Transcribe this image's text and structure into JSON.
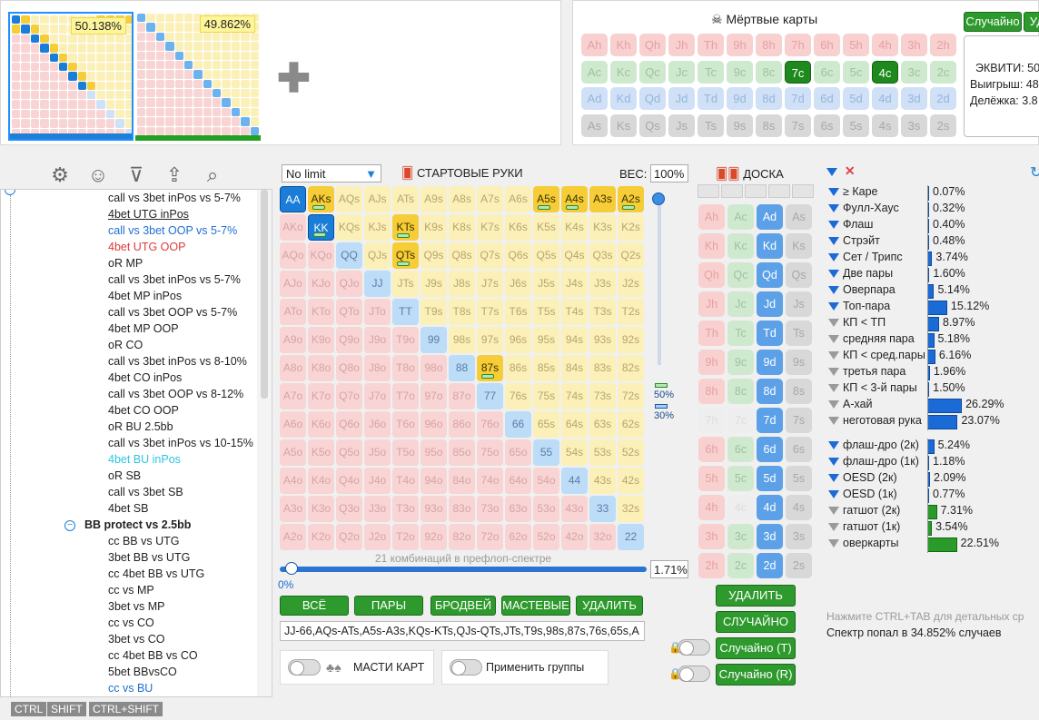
{
  "top": {
    "range1_pct": "50.138%",
    "range2_pct": "49.862%",
    "plus_icon": "plus-icon"
  },
  "dead": {
    "title": "Мёртвые карты",
    "random_btn": "Случайно",
    "delete_btn": "УД",
    "ranks": [
      "A",
      "K",
      "Q",
      "J",
      "T",
      "9",
      "8",
      "7",
      "6",
      "5",
      "4",
      "3",
      "2"
    ],
    "suits": [
      "h",
      "c",
      "d",
      "s"
    ],
    "selected": [
      "7c",
      "4c"
    ],
    "equity_label": "ЭКВИТИ: 50",
    "wins_label": "Выигрыш: 48",
    "split_label": "Делёжка: 3.8"
  },
  "toolbar": {
    "icons": [
      "gear-icon",
      "user-icon",
      "filter-add-icon",
      "export-icon",
      "search-icon"
    ]
  },
  "tree": {
    "items": [
      {
        "label": "call vs 3bet inPos vs 5-7%",
        "color": "#222"
      },
      {
        "label": "4bet UTG inPos",
        "color": "#222",
        "underline": true
      },
      {
        "label": "call  vs 3bet OOP vs 5-7%",
        "color": "#1f6fd1"
      },
      {
        "label": "4bet UTG OOP",
        "color": "#e03a3a"
      },
      {
        "label": "oR MP",
        "color": "#222"
      },
      {
        "label": "call vs 3bet inPos vs 5-7%",
        "color": "#222"
      },
      {
        "label": "4bet MP inPos",
        "color": "#222"
      },
      {
        "label": "call vs 3bet OOP vs 5-7%",
        "color": "#222"
      },
      {
        "label": "4bet MP OOP",
        "color": "#222"
      },
      {
        "label": "oR CO",
        "color": "#222"
      },
      {
        "label": "call vs 3bet inPos vs 8-10%",
        "color": "#222"
      },
      {
        "label": "4bet CO inPos",
        "color": "#222"
      },
      {
        "label": "call vs 3bet OOP vs 8-12%",
        "color": "#222"
      },
      {
        "label": "4bet CO OOP",
        "color": "#222"
      },
      {
        "label": "oR BU 2.5bb",
        "color": "#222"
      },
      {
        "label": "call vs 3bet inPos vs 10-15%",
        "color": "#222"
      },
      {
        "label": "4bet BU inPos",
        "color": "#2cc6e0"
      },
      {
        "label": "oR SB",
        "color": "#222"
      },
      {
        "label": "call vs 3bet SB",
        "color": "#222"
      },
      {
        "label": "4bet SB",
        "color": "#222"
      }
    ],
    "group_label": "BB protect vs 2.5bb",
    "group_items": [
      {
        "label": "cc BB vs UTG",
        "color": "#222"
      },
      {
        "label": "3bet BB vs UTG",
        "color": "#222"
      },
      {
        "label": "cc 4bet BB vs UTG",
        "color": "#222"
      },
      {
        "label": "cc vs MP",
        "color": "#222"
      },
      {
        "label": "3bet vs MP",
        "color": "#222"
      },
      {
        "label": "cc vs CO",
        "color": "#222"
      },
      {
        "label": "3bet vs CO",
        "color": "#222"
      },
      {
        "label": "cc 4bet BB vs CO",
        "color": "#222"
      },
      {
        "label": "5bet BBvsCO",
        "color": "#222"
      },
      {
        "label": "cc vs BU",
        "color": "#1f6fd1"
      }
    ],
    "kbd": [
      "CTRL",
      "SHIFT",
      "CTRL+SHIFT"
    ]
  },
  "range": {
    "limit_select": "No limit",
    "title": "СТАРТОВЫЕ РУКИ",
    "weight_label": "ВЕС:",
    "weight_value": "100%",
    "combos_text": "21 комбинаций в префлоп-спектре",
    "slider_min": "0%",
    "slider_value": "1.71%",
    "slider_fraction": 0.0171,
    "side_50": "50%",
    "side_30": "30%",
    "buttons": [
      "ВСЁ",
      "ПАРЫ",
      "БРОДВЕЙ",
      "МАСТЕВЫЕ",
      "УДАЛИТЬ"
    ],
    "range_text": "JJ-66,AQs-ATs,A5s-A3s,KQs-KTs,QJs-QTs,JTs,T9s,98s,87s,76s,65s,A",
    "suits_toggle": "МАСТИ КАРТ",
    "groups_toggle": "Применить группы",
    "selected": [
      "AA",
      "KK",
      "AKs",
      "A5s",
      "A4s",
      "A3s",
      "A2s",
      "KTs",
      "QTs",
      "87s"
    ],
    "dark": [
      "AA",
      "KK"
    ],
    "marked": [
      "AKs",
      "KK",
      "A5s",
      "A4s",
      "A2s",
      "KTs",
      "QTs",
      "87s"
    ],
    "light_pairs": [
      "QQ",
      "JJ",
      "TT",
      "99",
      "88",
      "77",
      "66",
      "55",
      "44",
      "33",
      "22"
    ]
  },
  "board": {
    "title": "ДОСКА",
    "delete_btn": "УДАЛИТЬ",
    "random_btn": "СЛУЧАЙНО",
    "random_t": "Случайно (T)",
    "random_r": "Случайно (R)",
    "selected": [
      "Ad",
      "Kd",
      "Qd",
      "Jd",
      "Td",
      "9d",
      "8d",
      "7d",
      "6d",
      "5d",
      "4d",
      "3d",
      "2d"
    ],
    "faded": [
      "7h",
      "7c",
      "4c"
    ]
  },
  "stats": {
    "rows": [
      {
        "label": "≥ Каре",
        "value": "0.07%",
        "pct": 0.07,
        "funnel": "blue"
      },
      {
        "label": "Фулл-Хаус",
        "value": "0.32%",
        "pct": 0.32,
        "funnel": "blue"
      },
      {
        "label": "Флаш",
        "value": "0.40%",
        "pct": 0.4,
        "funnel": "blue"
      },
      {
        "label": "Стрэйт",
        "value": "0.48%",
        "pct": 0.48,
        "funnel": "blue"
      },
      {
        "label": "Сет / Трипс",
        "value": "3.74%",
        "pct": 3.74,
        "funnel": "blue"
      },
      {
        "label": "Две пары",
        "value": "1.60%",
        "pct": 1.6,
        "funnel": "blue"
      },
      {
        "label": "Оверпара",
        "value": "5.14%",
        "pct": 5.14,
        "funnel": "blue"
      },
      {
        "label": "Топ-пара",
        "value": "15.12%",
        "pct": 15.12,
        "funnel": "blue"
      },
      {
        "label": "КП < ТП",
        "value": "8.97%",
        "pct": 8.97,
        "funnel": "grey"
      },
      {
        "label": "средняя пара",
        "value": "5.18%",
        "pct": 5.18,
        "funnel": "grey"
      },
      {
        "label": "КП < сред.пары",
        "value": "6.16%",
        "pct": 6.16,
        "funnel": "grey"
      },
      {
        "label": "третья пара",
        "value": "1.96%",
        "pct": 1.96,
        "funnel": "grey"
      },
      {
        "label": "КП < 3-й пары",
        "value": "1.50%",
        "pct": 1.5,
        "funnel": "grey"
      },
      {
        "label": "А-хай",
        "value": "26.29%",
        "pct": 26.29,
        "funnel": "grey"
      },
      {
        "label": "неготовая рука",
        "value": "23.07%",
        "pct": 23.07,
        "funnel": "grey"
      }
    ],
    "draws": [
      {
        "label": "флаш-дро (2к)",
        "value": "5.24%",
        "pct": 5.24,
        "funnel": "blue"
      },
      {
        "label": "флаш-дро (1к)",
        "value": "1.18%",
        "pct": 1.18,
        "funnel": "blue"
      },
      {
        "label": "OESD (2к)",
        "value": "2.09%",
        "pct": 2.09,
        "funnel": "blue"
      },
      {
        "label": "OESD (1к)",
        "value": "0.77%",
        "pct": 0.77,
        "funnel": "blue"
      },
      {
        "label": "гатшот (2к)",
        "value": "7.31%",
        "pct": 7.31,
        "funnel": "grey"
      },
      {
        "label": "гатшот (1к)",
        "value": "3.54%",
        "pct": 3.54,
        "funnel": "grey"
      },
      {
        "label": "оверкарты",
        "value": "22.51%",
        "pct": 22.51,
        "funnel": "grey"
      }
    ],
    "hint": "Нажмите CTRL+TAB для детальных ср",
    "hit": "Спектр попал в 34.852% случаев"
  }
}
